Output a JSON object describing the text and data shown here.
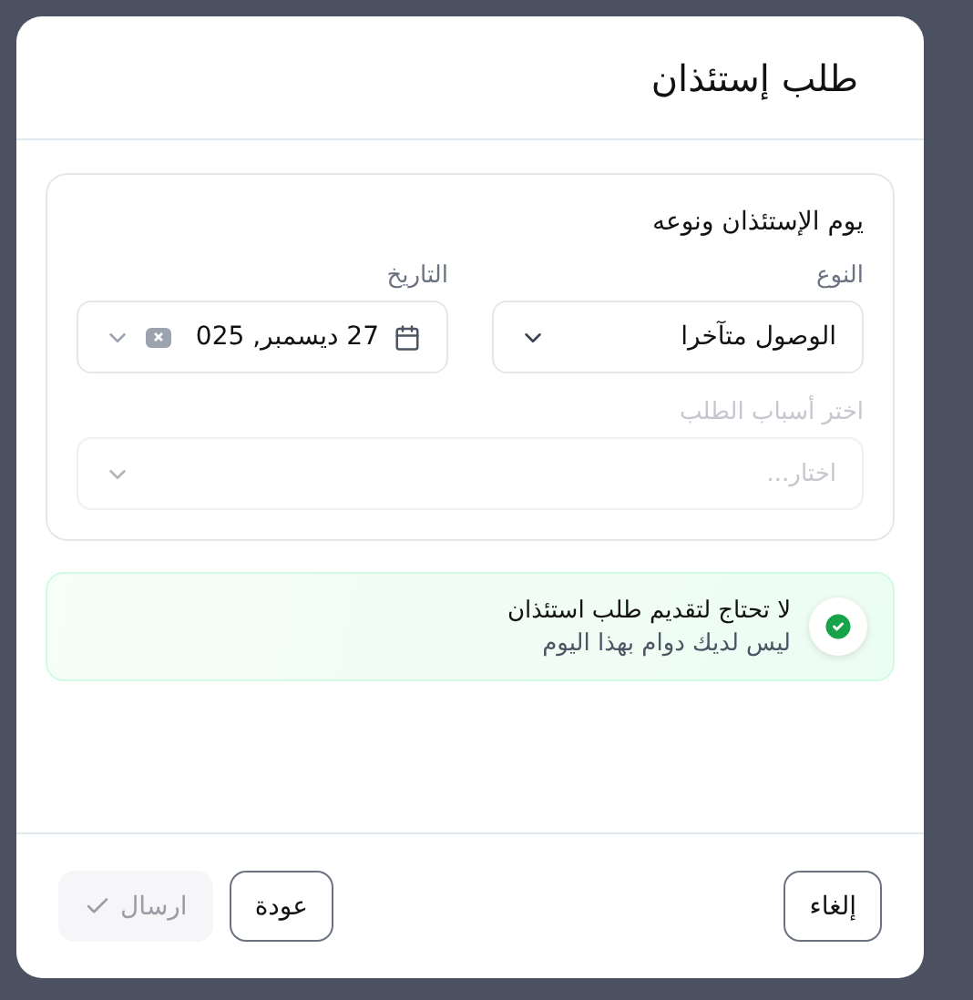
{
  "dialog": {
    "title": "طلب إستئذان"
  },
  "section": {
    "title": "يوم الإستئذان ونوعه",
    "fields": [
      {
        "kind": "select",
        "label": "النوع",
        "value": "الوصول متآخرا"
      },
      {
        "kind": "date",
        "label": "التاريخ",
        "value": "27 ديسمبر, 025"
      }
    ],
    "reasons": {
      "label": "اختر أسباب الطلب",
      "placeholder": "اختار...",
      "disabled": true
    }
  },
  "notice": {
    "title": "لا تحتاج لتقديم طلب استئذان",
    "message": "ليس لديك دوام بهذا اليوم"
  },
  "buttons": [
    {
      "kind": "outline",
      "label": "إلغاء",
      "disabled": false
    },
    {
      "kind": "outline",
      "label": "عودة",
      "disabled": false
    },
    {
      "kind": "submit",
      "label": "ارسال",
      "disabled": true
    }
  ]
}
